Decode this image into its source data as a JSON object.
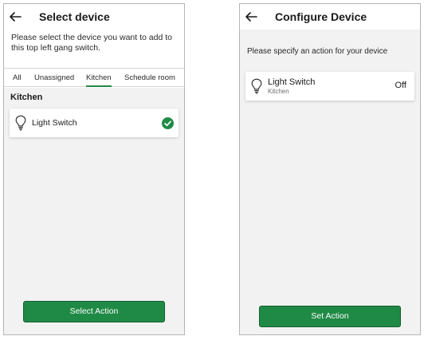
{
  "select_device_screen": {
    "title": "Select device",
    "instruction": "Please select the device you want to add to this top left gang switch.",
    "tabs": [
      {
        "label": "All",
        "active": false
      },
      {
        "label": "Unassigned",
        "active": false
      },
      {
        "label": "Kitchen",
        "active": true
      },
      {
        "label": "Schedule room",
        "active": false
      }
    ],
    "section_heading": "Kitchen",
    "device": {
      "name": "Light Switch",
      "icon": "lightbulb-icon",
      "selected": true,
      "selected_icon": "check-circle-icon"
    },
    "button_label": "Select Action",
    "back_icon": "arrow-left-icon"
  },
  "configure_device_screen": {
    "title": "Configure Device",
    "instruction": "Please specify an action for your device",
    "device": {
      "name": "Light Switch",
      "room": "Kitchen",
      "icon": "lightbulb-icon",
      "state": "Off"
    },
    "button_label": "Set Action",
    "back_icon": "arrow-left-icon"
  },
  "colors": {
    "accent": "#1f8a46",
    "background": "#f2f2f2",
    "card": "#ffffff"
  }
}
